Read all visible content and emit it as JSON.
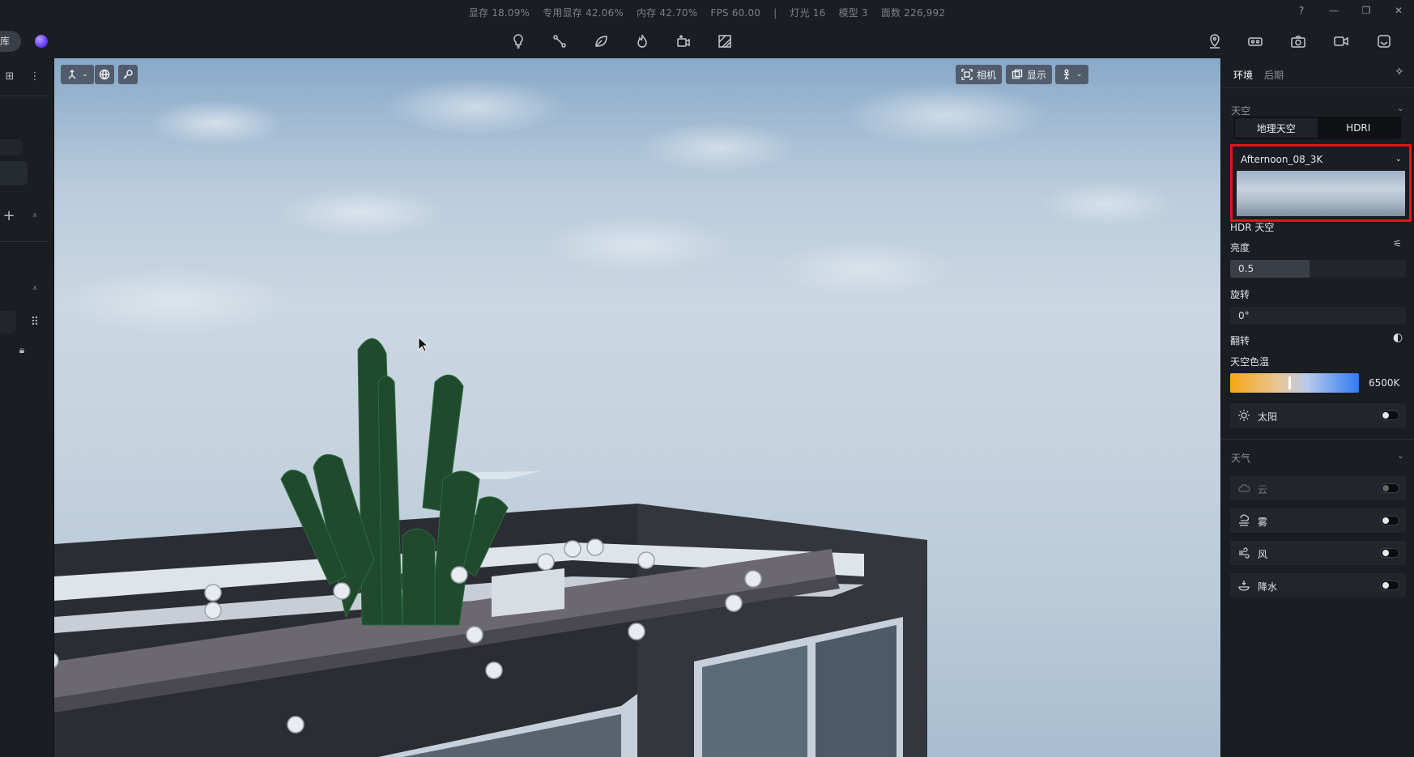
{
  "stats": {
    "vram": "显存 18.09%",
    "dedicated_vram": "专用显存 42.06%",
    "memory": "内存 42.70%",
    "fps": "FPS 60.00",
    "sep": "|",
    "lights": "灯光 16",
    "models": "模型 3",
    "faces": "面数 226,992"
  },
  "left": {
    "library_label": "库"
  },
  "viewport": {
    "camera_label": "相机",
    "display_label": "显示"
  },
  "right": {
    "tabs": {
      "environment": "环境",
      "post": "后期"
    },
    "sky_section": "天空",
    "sky_modes": {
      "geo": "地理天空",
      "hdri": "HDRI"
    },
    "hdri_selected": "Afternoon_08_3K",
    "hdr_sky_label": "HDR 天空",
    "brightness_label": "亮度",
    "brightness_value": "0.5",
    "brightness_fraction": 0.45,
    "rotation_label": "旋转",
    "rotation_value": "0°",
    "flip_label": "翻转",
    "color_temp_label": "天空色温",
    "color_temp_value": "6500K",
    "sun_label": "太阳",
    "weather_section": "天气",
    "cloud_label": "云",
    "fog_label": "雾",
    "wind_label": "风",
    "rain_label": "降水"
  },
  "colors": {
    "highlight": "#e6141b",
    "panel": "#1a1d22",
    "accent_blue": "#2f7cf2"
  }
}
